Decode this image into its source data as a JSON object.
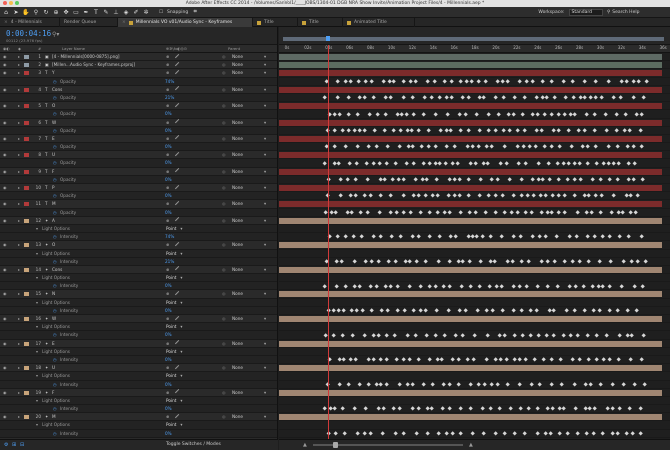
{
  "window": {
    "title": "Adobe After Effects CC 2014 - /Volumes/SanVol1/____JOBS/1304-01 DGB NRA Show Invite/Animation Project Files/4 - Millennials.aep *"
  },
  "toolbar": {
    "snapping": "Snapping",
    "workspace_label": "Workspace:",
    "workspace_value": "Standard",
    "search_placeholder": "Search Help"
  },
  "tabs": [
    {
      "label": "4 - Millennials",
      "active": false
    },
    {
      "label": "Render Queue",
      "active": false
    },
    {
      "label": "Millennials VO v01/Audio Sync - Keyframes",
      "active": true
    },
    {
      "label": "Title",
      "active": false
    },
    {
      "label": "Title",
      "active": false
    },
    {
      "label": "Animated Title",
      "active": false
    }
  ],
  "comp": {
    "timecode": "0:00:04:16",
    "frameinfo": "00112 (23.976 fps)"
  },
  "columns": {
    "num": "#",
    "layer_name": "Layer Name",
    "parent": "Parent"
  },
  "rows": [
    {
      "kind": "layer",
      "num": "1",
      "name": "[4 - Millennials[0000-0875].png]",
      "parent": "None",
      "color": "#8e9ba6",
      "type": "▣"
    },
    {
      "kind": "layer",
      "num": "2",
      "name": "[Millen...Audio Sync - Keyframes.prproj]",
      "parent": "None",
      "color": "#8e9ba6",
      "type": "▣"
    },
    {
      "kind": "layer",
      "num": "3",
      "name": "Y",
      "parent": "None",
      "color": "#b23a3a",
      "type": "T"
    },
    {
      "kind": "prop",
      "name": "Opacity",
      "value": "74%"
    },
    {
      "kind": "layer",
      "num": "4",
      "name": "Cons",
      "parent": "None",
      "color": "#b23a3a",
      "type": "T"
    },
    {
      "kind": "prop",
      "name": "Opacity",
      "value": "21%"
    },
    {
      "kind": "layer",
      "num": "5",
      "name": "O",
      "parent": "None",
      "color": "#b23a3a",
      "type": "T"
    },
    {
      "kind": "prop",
      "name": "Opacity",
      "value": "0%"
    },
    {
      "kind": "layer",
      "num": "6",
      "name": "W",
      "parent": "None",
      "color": "#b23a3a",
      "type": "T"
    },
    {
      "kind": "prop",
      "name": "Opacity",
      "value": "0%"
    },
    {
      "kind": "layer",
      "num": "7",
      "name": "E",
      "parent": "None",
      "color": "#b23a3a",
      "type": "T"
    },
    {
      "kind": "prop",
      "name": "Opacity",
      "value": "0%"
    },
    {
      "kind": "layer",
      "num": "8",
      "name": "U",
      "parent": "None",
      "color": "#b23a3a",
      "type": "T"
    },
    {
      "kind": "prop",
      "name": "Opacity",
      "value": "0%"
    },
    {
      "kind": "layer",
      "num": "9",
      "name": "F",
      "parent": "None",
      "color": "#b23a3a",
      "type": "T"
    },
    {
      "kind": "prop",
      "name": "Opacity",
      "value": "0%"
    },
    {
      "kind": "layer",
      "num": "10",
      "name": "P",
      "parent": "None",
      "color": "#b23a3a",
      "type": "T"
    },
    {
      "kind": "prop",
      "name": "Opacity",
      "value": "0%"
    },
    {
      "kind": "layer",
      "num": "11",
      "name": "M",
      "parent": "None",
      "color": "#b23a3a",
      "type": "T"
    },
    {
      "kind": "prop",
      "name": "Opacity",
      "value": "0%"
    },
    {
      "kind": "layer",
      "num": "12",
      "name": "A",
      "parent": "None",
      "color": "#c8a47a",
      "type": "✦"
    },
    {
      "kind": "propgroup",
      "name": "Light Options",
      "mode": "Point"
    },
    {
      "kind": "prop",
      "name": "Intensity",
      "value": "74%"
    },
    {
      "kind": "layer",
      "num": "13",
      "name": "O",
      "parent": "None",
      "color": "#c8a47a",
      "type": "✦"
    },
    {
      "kind": "propgroup",
      "name": "Light Options",
      "mode": "Point"
    },
    {
      "kind": "prop",
      "name": "Intensity",
      "value": "21%"
    },
    {
      "kind": "layer",
      "num": "14",
      "name": "Cons",
      "parent": "None",
      "color": "#c8a47a",
      "type": "✦"
    },
    {
      "kind": "propgroup",
      "name": "Light Options",
      "mode": "Point"
    },
    {
      "kind": "prop",
      "name": "Intensity",
      "value": "0%"
    },
    {
      "kind": "layer",
      "num": "15",
      "name": "N",
      "parent": "None",
      "color": "#c8a47a",
      "type": "✦"
    },
    {
      "kind": "propgroup",
      "name": "Light Options",
      "mode": "Point"
    },
    {
      "kind": "prop",
      "name": "Intensity",
      "value": "0%"
    },
    {
      "kind": "layer",
      "num": "16",
      "name": "W",
      "parent": "None",
      "color": "#c8a47a",
      "type": "✦"
    },
    {
      "kind": "propgroup",
      "name": "Light Options",
      "mode": "Point"
    },
    {
      "kind": "prop",
      "name": "Intensity",
      "value": "0%"
    },
    {
      "kind": "layer",
      "num": "17",
      "name": "E",
      "parent": "None",
      "color": "#c8a47a",
      "type": "✦"
    },
    {
      "kind": "propgroup",
      "name": "Light Options",
      "mode": "Point"
    },
    {
      "kind": "prop",
      "name": "Intensity",
      "value": "0%"
    },
    {
      "kind": "layer",
      "num": "18",
      "name": "U",
      "parent": "None",
      "color": "#c8a47a",
      "type": "✦"
    },
    {
      "kind": "propgroup",
      "name": "Light Options",
      "mode": "Point"
    },
    {
      "kind": "prop",
      "name": "Intensity",
      "value": "0%"
    },
    {
      "kind": "layer",
      "num": "19",
      "name": "F",
      "parent": "None",
      "color": "#c8a47a",
      "type": "✦"
    },
    {
      "kind": "propgroup",
      "name": "Light Options",
      "mode": "Point"
    },
    {
      "kind": "prop",
      "name": "Intensity",
      "value": "0%"
    },
    {
      "kind": "layer",
      "num": "20",
      "name": "M",
      "parent": "None",
      "color": "#c8a47a",
      "type": "✦"
    },
    {
      "kind": "propgroup",
      "name": "Light Options",
      "mode": "Point"
    },
    {
      "kind": "prop",
      "name": "Intensity",
      "value": "0%"
    },
    {
      "kind": "layer",
      "num": "21",
      "name": "[NRA Millennials MIX v01.wav]",
      "parent": "None",
      "color": "#8e9ba6",
      "type": "♫"
    }
  ],
  "ruler": [
    "0s",
    "02s",
    "04s",
    "06s",
    "08s",
    "10s",
    "12s",
    "14s",
    "16s",
    "18s",
    "20s",
    "22s",
    "24s",
    "26s",
    "28s",
    "30s",
    "32s",
    "34s",
    "36s"
  ],
  "footer": {
    "toggle": "Toggle Switches / Modes"
  },
  "colors": {
    "accent": "#4e9ff5",
    "cti": "#d13a3a",
    "text_bar": "#7c2b2b",
    "light_bar": "#a08672",
    "footage_bar": "#5e6a64",
    "audio_bar": "#5e6a64"
  }
}
